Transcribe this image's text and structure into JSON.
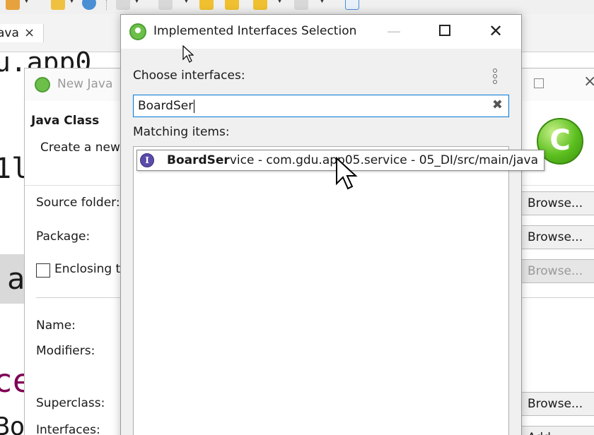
{
  "editor": {
    "tab_label": "ava",
    "tab_close": "×",
    "code_lines": [
      "u.app0",
      "1l",
      "a",
      "ce",
      "Bo"
    ]
  },
  "new_class_wizard": {
    "title": "New Java",
    "heading": "Java Class",
    "description": "Create a new",
    "fields": {
      "source_folder": "Source folder:",
      "package": "Package:",
      "enclosing_type": "Enclosing t",
      "name": "Name:",
      "modifiers": "Modifiers:",
      "superclass": "Superclass:",
      "interfaces": "Interfaces:"
    },
    "browse_label": "Browse...",
    "add_label": "Add...",
    "banner_letter": "C",
    "close_glyph": "×"
  },
  "dialog": {
    "title": "Implemented Interfaces Selection",
    "minimize_glyph": "—",
    "close_glyph": "✕",
    "choose_label": "Choose interfaces:",
    "search": {
      "value": "BoardSer",
      "clear_glyph": "✖"
    },
    "matching_label": "Matching items:",
    "results": [
      {
        "icon": "interface-icon",
        "icon_letter": "I",
        "match": "BoardSer",
        "rest": "vice",
        "qualifier": " - com.gdu.app05.service - 05_DI/src/main/java"
      }
    ]
  },
  "colors": {
    "accent": "#0078d7",
    "interface_icon": "#5a4ca8",
    "spring_green": "#6cc04a",
    "keyword": "#7f0055"
  }
}
